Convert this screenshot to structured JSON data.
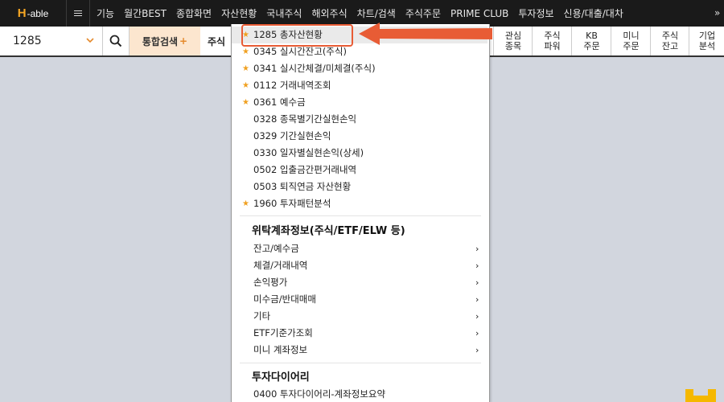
{
  "app": {
    "logo_h": "H",
    "logo_text": "-able"
  },
  "nav": {
    "items": [
      "기능",
      "월간BEST",
      "종합화면",
      "자산현황",
      "국내주식",
      "해외주식",
      "차트/검색",
      "주식주문",
      "PRIME CLUB",
      "투자정보",
      "신용/대출/대차"
    ],
    "more": "»"
  },
  "toolbar": {
    "code_value": "1285",
    "integrated_search": "통합검색",
    "integrated_search_plus": "+",
    "stock_tab": "주식",
    "quick_buttons": [
      {
        "line1": "관심",
        "line2": "종목"
      },
      {
        "line1": "주식",
        "line2": "파워"
      },
      {
        "line1": "KB",
        "line2": "주문"
      },
      {
        "line1": "미니",
        "line2": "주문"
      },
      {
        "line1": "주식",
        "line2": "잔고"
      },
      {
        "line1": "기업",
        "line2": "분석"
      }
    ]
  },
  "dropdown": {
    "favorites": [
      {
        "label": "1285 총자산현황",
        "star": true,
        "selected": true
      },
      {
        "label": "0345 실시간잔고(주식)",
        "star": true
      },
      {
        "label": "0341 실시간체결/미체결(주식)",
        "star": true
      },
      {
        "label": "0112 거래내역조회",
        "star": true
      },
      {
        "label": "0361 예수금",
        "star": true
      },
      {
        "label": "0328 종목별기간실현손익",
        "star": false
      },
      {
        "label": "0329 기간실현손익",
        "star": false
      },
      {
        "label": "0330 일자별실현손익(상세)",
        "star": false
      },
      {
        "label": "0502 입출금간편거래내역",
        "star": false
      },
      {
        "label": "0503 퇴직연금 자산현황",
        "star": false
      },
      {
        "label": "1960 투자패턴분석",
        "star": true
      }
    ],
    "star_glyph": "★",
    "section1_title": "위탁계좌정보(주식/ETF/ELW 등)",
    "section1_items": [
      "잔고/예수금",
      "체결/거래내역",
      "손익평가",
      "미수금/반대매매",
      "기타",
      "ETF기준가조회",
      "미니 계좌정보"
    ],
    "submenu_arrow": "›",
    "section2_title": "투자다이어리",
    "section2_items": [
      "0400 투자다이어리-계좌정보요약"
    ]
  },
  "colors": {
    "accent": "#e85c35",
    "star": "#f0a020",
    "brand": "#f5a623"
  }
}
